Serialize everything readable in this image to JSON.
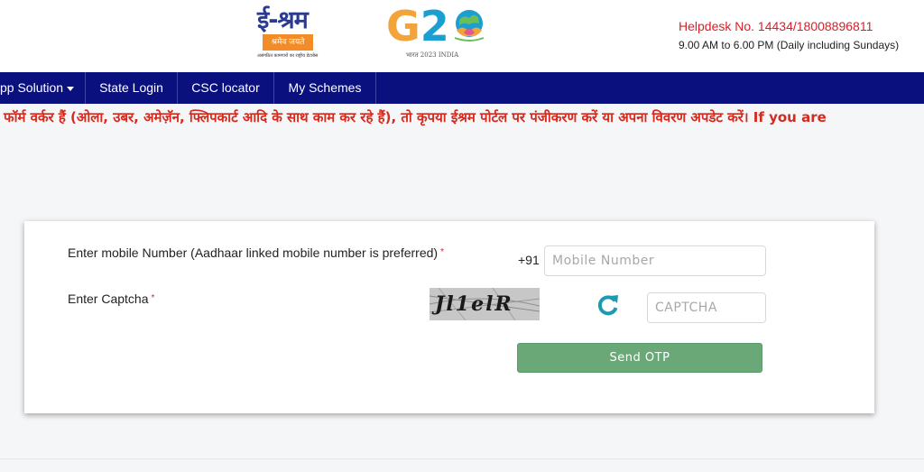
{
  "header": {
    "logo_eshram": {
      "title": "ई-श्रम",
      "band": "श्रमेव जयते",
      "tagline": "असंगठित कामगारों का राष्ट्रीय डेटाबेस"
    },
    "logo_g20": {
      "letters_g": "G",
      "letters_2": "2",
      "sub": "भारत 2023 INDIA"
    },
    "helpdesk": "Helpdesk No. 14434/18008896811",
    "hours": "9.00 AM to 6.00 PM (Daily including Sundays)"
  },
  "nav": {
    "items": [
      {
        "label": "pp Solution"
      },
      {
        "label": "State Login"
      },
      {
        "label": "CSC locator"
      },
      {
        "label": "My Schemes"
      }
    ]
  },
  "marquee": {
    "text": "फॉर्म वर्कर हैं (ओला, उबर, अमेज़ॅन, फ्लिपकार्ट आदि के साथ काम कर रहे हैं), तो कृपया ईश्रम पोर्टल पर पंजीकरण करें या अपना विवरण अपडेट करें। If you are"
  },
  "form": {
    "mobile_label": "Enter mobile Number (Aadhaar linked mobile number is preferred)",
    "required_mark": "*",
    "country_code": "+91",
    "mobile_placeholder": "Mobile Number",
    "mobile_value": "",
    "captcha_label": "Enter Captcha",
    "captcha_image_text": "Jl1elR",
    "captcha_placeholder": "CAPTCHA",
    "captcha_value": "",
    "send_otp_label": "Send OTP"
  },
  "colors": {
    "nav_bg": "#0a107e",
    "marquee_text": "#d42b1e",
    "helpdesk": "#d92027",
    "button": "#6aa878",
    "refresh_icon": "#1a9cb0"
  },
  "icons": {
    "refresh": "refresh-icon",
    "caret": "caret-down-icon"
  }
}
